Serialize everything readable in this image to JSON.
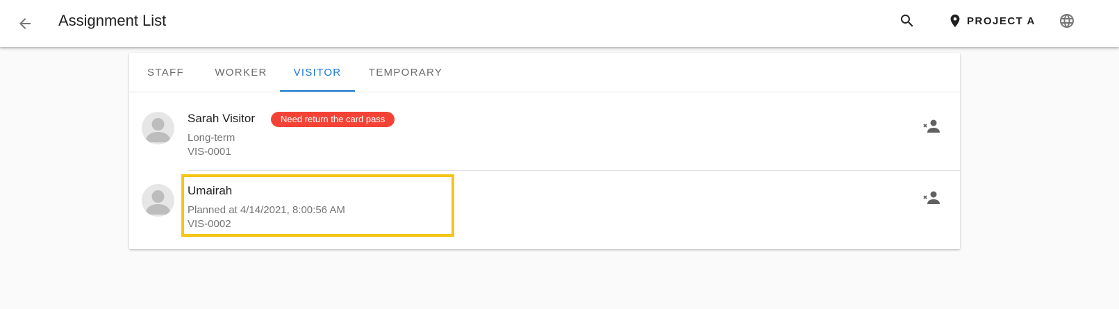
{
  "app_bar": {
    "title": "Assignment List",
    "project_label": "PROJECT A",
    "icons": {
      "back": "arrow-back-icon",
      "search": "search-icon",
      "project": "location-pin-icon",
      "language": "globe-icon"
    }
  },
  "tabs": [
    {
      "label": "STAFF",
      "active": false
    },
    {
      "label": "WORKER",
      "active": false
    },
    {
      "label": "VISITOR",
      "active": true
    },
    {
      "label": "TEMPORARY",
      "active": false
    }
  ],
  "list": [
    {
      "name": "Sarah Visitor",
      "badge": "Need return the card pass",
      "line1": "Long-term",
      "line2": "VIS-0001",
      "action_icon": "remove-user-icon"
    },
    {
      "name": "Umairah",
      "line1": "Planned at 4/14/2021, 8:00:56 AM",
      "line2": "VIS-0002",
      "action_icon": "remove-user-icon"
    }
  ],
  "colors": {
    "accent": "#1976d2",
    "badge": "#f44336",
    "highlight": "#f5c518",
    "background": "#fafafa"
  }
}
